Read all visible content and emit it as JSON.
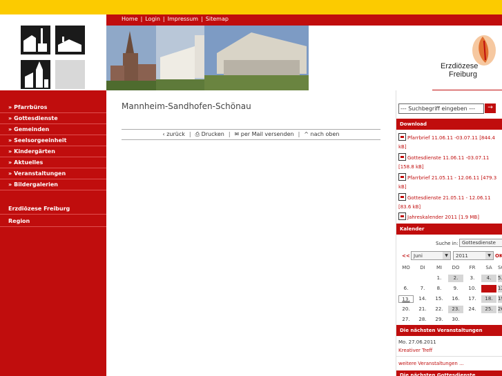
{
  "topnav": {
    "items": [
      "Home",
      "Login",
      "Impressum",
      "Sitemap"
    ]
  },
  "logo": {
    "line1": "Erzdiözese",
    "line2": "Freiburg"
  },
  "leftnav": {
    "items": [
      "Pfarrbüros",
      "Gottesdienste",
      "Gemeinden",
      "Seelsorgeeinheit",
      "Kindergärten",
      "Aktuelles",
      "Veranstaltungen",
      "Bildergalerien"
    ],
    "bottom": [
      "Erzdiözese Freiburg",
      "Region"
    ]
  },
  "main": {
    "title": "Mannheim-Sandhofen-Schönau",
    "tools": {
      "back": "zurück",
      "print": "Drucken",
      "mail": "per Mail versenden",
      "top": "nach oben"
    }
  },
  "search": {
    "placeholder": "--- Suchbegriff eingeben ---",
    "button": "→"
  },
  "download": {
    "title": "Download",
    "items": [
      "Pfarrbrief 11.06.11 -03.07.11 [844.4 kB]",
      "Gottesdienste 11.06.11 -03.07.11 [158.8 kB]",
      "Pfarrbrief 21.05.11 - 12.06.11 [479.3 kB]",
      "Gottesdienste 21.05.11 - 12.06.11 [83.6 kB]",
      "Jahreskalender 2011 [1.9 MB]"
    ]
  },
  "calendar": {
    "title": "Kalender",
    "search_label": "Suche in:",
    "search_value": "Gottesdienste",
    "prev": "<<",
    "month": "Juni",
    "year": "2011",
    "ok": "OK",
    "weekdays": [
      "MO",
      "DI",
      "MI",
      "DO",
      "FR",
      "SA",
      "SO"
    ],
    "weeks": [
      [
        "",
        "",
        "1.",
        "2.",
        "3.",
        "4.",
        "5."
      ],
      [
        "6.",
        "7.",
        "8.",
        "9.",
        "10.",
        "11.",
        "12."
      ],
      [
        "13.",
        "14.",
        "15.",
        "16.",
        "17.",
        "18.",
        "19."
      ],
      [
        "20.",
        "21.",
        "22.",
        "23.",
        "24.",
        "25.",
        "26."
      ],
      [
        "27.",
        "28.",
        "29.",
        "30.",
        "",
        "",
        ""
      ]
    ]
  },
  "events": {
    "title": "Die nächsten Veranstaltungen",
    "date": "Mo. 27.06.2011",
    "name": "Kreativer Treff",
    "more": "weitere Veranstaltungen ...",
    "next_title": "Die nächsten Gottesdienste"
  },
  "colors": {
    "brand_red": "#c00d0d",
    "brand_yellow": "#fccb00"
  }
}
